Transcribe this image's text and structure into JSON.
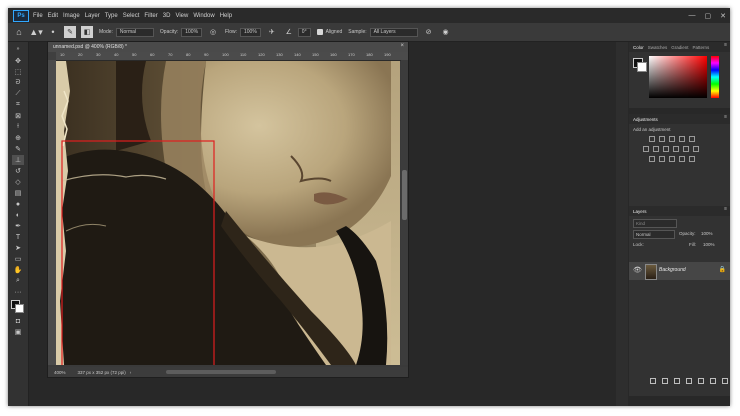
{
  "menubar": {
    "logo": "Ps",
    "items": [
      "File",
      "Edit",
      "Image",
      "Layer",
      "Type",
      "Select",
      "Filter",
      "3D",
      "View",
      "Window",
      "Help"
    ],
    "window_controls": [
      "—",
      "▢",
      "✕"
    ]
  },
  "options": {
    "mode_label": "Mode:",
    "mode_value": "Normal",
    "opacity_label": "Opacity:",
    "opacity_value": "100%",
    "flow_label": "Flow:",
    "flow_value": "100%",
    "angle_value": "0°",
    "aligned_label": "Aligned",
    "sample_label": "Sample:",
    "sample_value": "All Layers"
  },
  "document": {
    "tab_title": "unnamed.psd @ 400% (RGB/8) *",
    "close": "×",
    "ruler_ticks": [
      "10",
      "20",
      "30",
      "40",
      "50",
      "60",
      "70",
      "80",
      "90",
      "100",
      "110",
      "120",
      "130",
      "140",
      "150",
      "160",
      "170",
      "180",
      "190"
    ],
    "zoom": "400%",
    "size_info": "337 px x 352 px (72 ppi)"
  },
  "color_panel": {
    "tabs": [
      "Color",
      "Swatches",
      "Gradient",
      "Patterns"
    ],
    "fg_color": "#111111",
    "bg_color": "#ffffff"
  },
  "adjustments_panel": {
    "title": "Adjustments",
    "subtitle": "Add an adjustment"
  },
  "layers_panel": {
    "title": "Layers",
    "search_placeholder": "Kind",
    "blend_mode": "Normal",
    "opacity_label": "Opacity:",
    "opacity_value": "100%",
    "lock_label": "Lock:",
    "fill_label": "Fill:",
    "fill_value": "100%",
    "layer_name": "Background"
  },
  "selection": {
    "color": "#e01e1e"
  }
}
